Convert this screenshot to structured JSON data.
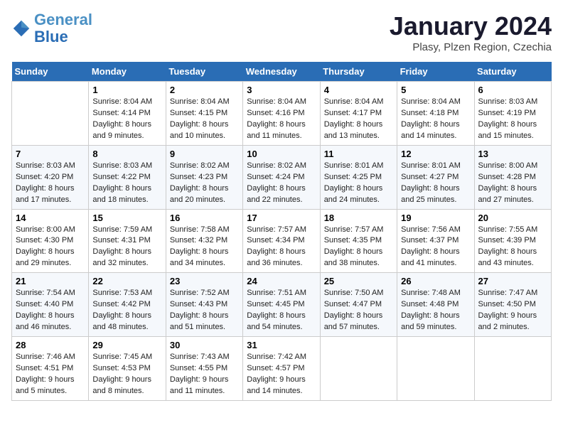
{
  "logo": {
    "line1": "General",
    "line2": "Blue"
  },
  "title": "January 2024",
  "subtitle": "Plasy, Plzen Region, Czechia",
  "days_header": [
    "Sunday",
    "Monday",
    "Tuesday",
    "Wednesday",
    "Thursday",
    "Friday",
    "Saturday"
  ],
  "weeks": [
    [
      {
        "num": "",
        "sunrise": "",
        "sunset": "",
        "daylight": ""
      },
      {
        "num": "1",
        "sunrise": "Sunrise: 8:04 AM",
        "sunset": "Sunset: 4:14 PM",
        "daylight": "Daylight: 8 hours and 9 minutes."
      },
      {
        "num": "2",
        "sunrise": "Sunrise: 8:04 AM",
        "sunset": "Sunset: 4:15 PM",
        "daylight": "Daylight: 8 hours and 10 minutes."
      },
      {
        "num": "3",
        "sunrise": "Sunrise: 8:04 AM",
        "sunset": "Sunset: 4:16 PM",
        "daylight": "Daylight: 8 hours and 11 minutes."
      },
      {
        "num": "4",
        "sunrise": "Sunrise: 8:04 AM",
        "sunset": "Sunset: 4:17 PM",
        "daylight": "Daylight: 8 hours and 13 minutes."
      },
      {
        "num": "5",
        "sunrise": "Sunrise: 8:04 AM",
        "sunset": "Sunset: 4:18 PM",
        "daylight": "Daylight: 8 hours and 14 minutes."
      },
      {
        "num": "6",
        "sunrise": "Sunrise: 8:03 AM",
        "sunset": "Sunset: 4:19 PM",
        "daylight": "Daylight: 8 hours and 15 minutes."
      }
    ],
    [
      {
        "num": "7",
        "sunrise": "Sunrise: 8:03 AM",
        "sunset": "Sunset: 4:20 PM",
        "daylight": "Daylight: 8 hours and 17 minutes."
      },
      {
        "num": "8",
        "sunrise": "Sunrise: 8:03 AM",
        "sunset": "Sunset: 4:22 PM",
        "daylight": "Daylight: 8 hours and 18 minutes."
      },
      {
        "num": "9",
        "sunrise": "Sunrise: 8:02 AM",
        "sunset": "Sunset: 4:23 PM",
        "daylight": "Daylight: 8 hours and 20 minutes."
      },
      {
        "num": "10",
        "sunrise": "Sunrise: 8:02 AM",
        "sunset": "Sunset: 4:24 PM",
        "daylight": "Daylight: 8 hours and 22 minutes."
      },
      {
        "num": "11",
        "sunrise": "Sunrise: 8:01 AM",
        "sunset": "Sunset: 4:25 PM",
        "daylight": "Daylight: 8 hours and 24 minutes."
      },
      {
        "num": "12",
        "sunrise": "Sunrise: 8:01 AM",
        "sunset": "Sunset: 4:27 PM",
        "daylight": "Daylight: 8 hours and 25 minutes."
      },
      {
        "num": "13",
        "sunrise": "Sunrise: 8:00 AM",
        "sunset": "Sunset: 4:28 PM",
        "daylight": "Daylight: 8 hours and 27 minutes."
      }
    ],
    [
      {
        "num": "14",
        "sunrise": "Sunrise: 8:00 AM",
        "sunset": "Sunset: 4:30 PM",
        "daylight": "Daylight: 8 hours and 29 minutes."
      },
      {
        "num": "15",
        "sunrise": "Sunrise: 7:59 AM",
        "sunset": "Sunset: 4:31 PM",
        "daylight": "Daylight: 8 hours and 32 minutes."
      },
      {
        "num": "16",
        "sunrise": "Sunrise: 7:58 AM",
        "sunset": "Sunset: 4:32 PM",
        "daylight": "Daylight: 8 hours and 34 minutes."
      },
      {
        "num": "17",
        "sunrise": "Sunrise: 7:57 AM",
        "sunset": "Sunset: 4:34 PM",
        "daylight": "Daylight: 8 hours and 36 minutes."
      },
      {
        "num": "18",
        "sunrise": "Sunrise: 7:57 AM",
        "sunset": "Sunset: 4:35 PM",
        "daylight": "Daylight: 8 hours and 38 minutes."
      },
      {
        "num": "19",
        "sunrise": "Sunrise: 7:56 AM",
        "sunset": "Sunset: 4:37 PM",
        "daylight": "Daylight: 8 hours and 41 minutes."
      },
      {
        "num": "20",
        "sunrise": "Sunrise: 7:55 AM",
        "sunset": "Sunset: 4:39 PM",
        "daylight": "Daylight: 8 hours and 43 minutes."
      }
    ],
    [
      {
        "num": "21",
        "sunrise": "Sunrise: 7:54 AM",
        "sunset": "Sunset: 4:40 PM",
        "daylight": "Daylight: 8 hours and 46 minutes."
      },
      {
        "num": "22",
        "sunrise": "Sunrise: 7:53 AM",
        "sunset": "Sunset: 4:42 PM",
        "daylight": "Daylight: 8 hours and 48 minutes."
      },
      {
        "num": "23",
        "sunrise": "Sunrise: 7:52 AM",
        "sunset": "Sunset: 4:43 PM",
        "daylight": "Daylight: 8 hours and 51 minutes."
      },
      {
        "num": "24",
        "sunrise": "Sunrise: 7:51 AM",
        "sunset": "Sunset: 4:45 PM",
        "daylight": "Daylight: 8 hours and 54 minutes."
      },
      {
        "num": "25",
        "sunrise": "Sunrise: 7:50 AM",
        "sunset": "Sunset: 4:47 PM",
        "daylight": "Daylight: 8 hours and 57 minutes."
      },
      {
        "num": "26",
        "sunrise": "Sunrise: 7:48 AM",
        "sunset": "Sunset: 4:48 PM",
        "daylight": "Daylight: 8 hours and 59 minutes."
      },
      {
        "num": "27",
        "sunrise": "Sunrise: 7:47 AM",
        "sunset": "Sunset: 4:50 PM",
        "daylight": "Daylight: 9 hours and 2 minutes."
      }
    ],
    [
      {
        "num": "28",
        "sunrise": "Sunrise: 7:46 AM",
        "sunset": "Sunset: 4:51 PM",
        "daylight": "Daylight: 9 hours and 5 minutes."
      },
      {
        "num": "29",
        "sunrise": "Sunrise: 7:45 AM",
        "sunset": "Sunset: 4:53 PM",
        "daylight": "Daylight: 9 hours and 8 minutes."
      },
      {
        "num": "30",
        "sunrise": "Sunrise: 7:43 AM",
        "sunset": "Sunset: 4:55 PM",
        "daylight": "Daylight: 9 hours and 11 minutes."
      },
      {
        "num": "31",
        "sunrise": "Sunrise: 7:42 AM",
        "sunset": "Sunset: 4:57 PM",
        "daylight": "Daylight: 9 hours and 14 minutes."
      },
      {
        "num": "",
        "sunrise": "",
        "sunset": "",
        "daylight": ""
      },
      {
        "num": "",
        "sunrise": "",
        "sunset": "",
        "daylight": ""
      },
      {
        "num": "",
        "sunrise": "",
        "sunset": "",
        "daylight": ""
      }
    ]
  ]
}
